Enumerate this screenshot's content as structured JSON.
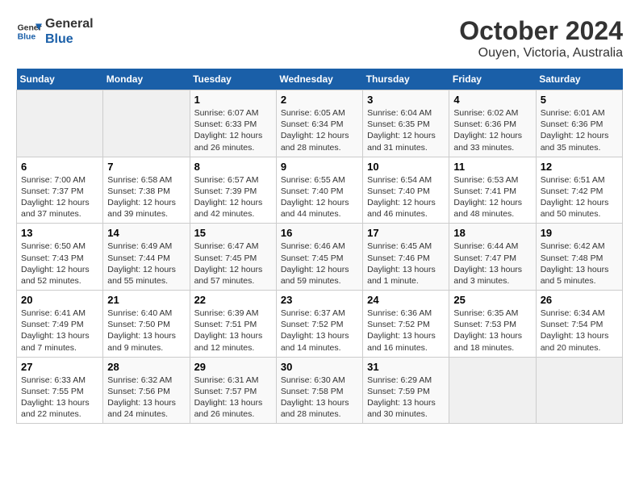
{
  "logo": {
    "text_general": "General",
    "text_blue": "Blue"
  },
  "title": "October 2024",
  "subtitle": "Ouyen, Victoria, Australia",
  "weekdays": [
    "Sunday",
    "Monday",
    "Tuesday",
    "Wednesday",
    "Thursday",
    "Friday",
    "Saturday"
  ],
  "weeks": [
    [
      {
        "day": "",
        "sunrise": "",
        "sunset": "",
        "daylight": ""
      },
      {
        "day": "",
        "sunrise": "",
        "sunset": "",
        "daylight": ""
      },
      {
        "day": "1",
        "sunrise": "Sunrise: 6:07 AM",
        "sunset": "Sunset: 6:33 PM",
        "daylight": "Daylight: 12 hours and 26 minutes."
      },
      {
        "day": "2",
        "sunrise": "Sunrise: 6:05 AM",
        "sunset": "Sunset: 6:34 PM",
        "daylight": "Daylight: 12 hours and 28 minutes."
      },
      {
        "day": "3",
        "sunrise": "Sunrise: 6:04 AM",
        "sunset": "Sunset: 6:35 PM",
        "daylight": "Daylight: 12 hours and 31 minutes."
      },
      {
        "day": "4",
        "sunrise": "Sunrise: 6:02 AM",
        "sunset": "Sunset: 6:36 PM",
        "daylight": "Daylight: 12 hours and 33 minutes."
      },
      {
        "day": "5",
        "sunrise": "Sunrise: 6:01 AM",
        "sunset": "Sunset: 6:36 PM",
        "daylight": "Daylight: 12 hours and 35 minutes."
      }
    ],
    [
      {
        "day": "6",
        "sunrise": "Sunrise: 7:00 AM",
        "sunset": "Sunset: 7:37 PM",
        "daylight": "Daylight: 12 hours and 37 minutes."
      },
      {
        "day": "7",
        "sunrise": "Sunrise: 6:58 AM",
        "sunset": "Sunset: 7:38 PM",
        "daylight": "Daylight: 12 hours and 39 minutes."
      },
      {
        "day": "8",
        "sunrise": "Sunrise: 6:57 AM",
        "sunset": "Sunset: 7:39 PM",
        "daylight": "Daylight: 12 hours and 42 minutes."
      },
      {
        "day": "9",
        "sunrise": "Sunrise: 6:55 AM",
        "sunset": "Sunset: 7:40 PM",
        "daylight": "Daylight: 12 hours and 44 minutes."
      },
      {
        "day": "10",
        "sunrise": "Sunrise: 6:54 AM",
        "sunset": "Sunset: 7:40 PM",
        "daylight": "Daylight: 12 hours and 46 minutes."
      },
      {
        "day": "11",
        "sunrise": "Sunrise: 6:53 AM",
        "sunset": "Sunset: 7:41 PM",
        "daylight": "Daylight: 12 hours and 48 minutes."
      },
      {
        "day": "12",
        "sunrise": "Sunrise: 6:51 AM",
        "sunset": "Sunset: 7:42 PM",
        "daylight": "Daylight: 12 hours and 50 minutes."
      }
    ],
    [
      {
        "day": "13",
        "sunrise": "Sunrise: 6:50 AM",
        "sunset": "Sunset: 7:43 PM",
        "daylight": "Daylight: 12 hours and 52 minutes."
      },
      {
        "day": "14",
        "sunrise": "Sunrise: 6:49 AM",
        "sunset": "Sunset: 7:44 PM",
        "daylight": "Daylight: 12 hours and 55 minutes."
      },
      {
        "day": "15",
        "sunrise": "Sunrise: 6:47 AM",
        "sunset": "Sunset: 7:45 PM",
        "daylight": "Daylight: 12 hours and 57 minutes."
      },
      {
        "day": "16",
        "sunrise": "Sunrise: 6:46 AM",
        "sunset": "Sunset: 7:45 PM",
        "daylight": "Daylight: 12 hours and 59 minutes."
      },
      {
        "day": "17",
        "sunrise": "Sunrise: 6:45 AM",
        "sunset": "Sunset: 7:46 PM",
        "daylight": "Daylight: 13 hours and 1 minute."
      },
      {
        "day": "18",
        "sunrise": "Sunrise: 6:44 AM",
        "sunset": "Sunset: 7:47 PM",
        "daylight": "Daylight: 13 hours and 3 minutes."
      },
      {
        "day": "19",
        "sunrise": "Sunrise: 6:42 AM",
        "sunset": "Sunset: 7:48 PM",
        "daylight": "Daylight: 13 hours and 5 minutes."
      }
    ],
    [
      {
        "day": "20",
        "sunrise": "Sunrise: 6:41 AM",
        "sunset": "Sunset: 7:49 PM",
        "daylight": "Daylight: 13 hours and 7 minutes."
      },
      {
        "day": "21",
        "sunrise": "Sunrise: 6:40 AM",
        "sunset": "Sunset: 7:50 PM",
        "daylight": "Daylight: 13 hours and 9 minutes."
      },
      {
        "day": "22",
        "sunrise": "Sunrise: 6:39 AM",
        "sunset": "Sunset: 7:51 PM",
        "daylight": "Daylight: 13 hours and 12 minutes."
      },
      {
        "day": "23",
        "sunrise": "Sunrise: 6:37 AM",
        "sunset": "Sunset: 7:52 PM",
        "daylight": "Daylight: 13 hours and 14 minutes."
      },
      {
        "day": "24",
        "sunrise": "Sunrise: 6:36 AM",
        "sunset": "Sunset: 7:52 PM",
        "daylight": "Daylight: 13 hours and 16 minutes."
      },
      {
        "day": "25",
        "sunrise": "Sunrise: 6:35 AM",
        "sunset": "Sunset: 7:53 PM",
        "daylight": "Daylight: 13 hours and 18 minutes."
      },
      {
        "day": "26",
        "sunrise": "Sunrise: 6:34 AM",
        "sunset": "Sunset: 7:54 PM",
        "daylight": "Daylight: 13 hours and 20 minutes."
      }
    ],
    [
      {
        "day": "27",
        "sunrise": "Sunrise: 6:33 AM",
        "sunset": "Sunset: 7:55 PM",
        "daylight": "Daylight: 13 hours and 22 minutes."
      },
      {
        "day": "28",
        "sunrise": "Sunrise: 6:32 AM",
        "sunset": "Sunset: 7:56 PM",
        "daylight": "Daylight: 13 hours and 24 minutes."
      },
      {
        "day": "29",
        "sunrise": "Sunrise: 6:31 AM",
        "sunset": "Sunset: 7:57 PM",
        "daylight": "Daylight: 13 hours and 26 minutes."
      },
      {
        "day": "30",
        "sunrise": "Sunrise: 6:30 AM",
        "sunset": "Sunset: 7:58 PM",
        "daylight": "Daylight: 13 hours and 28 minutes."
      },
      {
        "day": "31",
        "sunrise": "Sunrise: 6:29 AM",
        "sunset": "Sunset: 7:59 PM",
        "daylight": "Daylight: 13 hours and 30 minutes."
      },
      {
        "day": "",
        "sunrise": "",
        "sunset": "",
        "daylight": ""
      },
      {
        "day": "",
        "sunrise": "",
        "sunset": "",
        "daylight": ""
      }
    ]
  ]
}
